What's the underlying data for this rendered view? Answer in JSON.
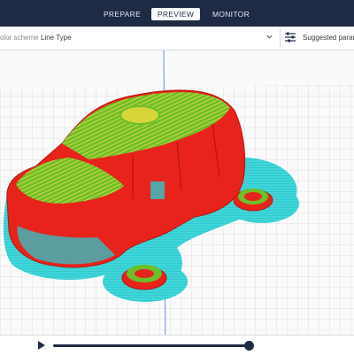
{
  "tabs": [
    {
      "label": "PREPARE",
      "active": false
    },
    {
      "label": "PREVIEW",
      "active": true
    },
    {
      "label": "MONITOR",
      "active": false
    }
  ],
  "toolbar": {
    "color_scheme_label": "olor scheme",
    "color_scheme_value": "Line Type",
    "suggested_label": "Suggested parame"
  },
  "timeline": {
    "progress": 0.95
  },
  "colors": {
    "header_bg": "#1f2a44",
    "wall_red": "#e8231b",
    "top_green": "#6dbf2b",
    "skirt_cyan": "#3dd6d8"
  }
}
